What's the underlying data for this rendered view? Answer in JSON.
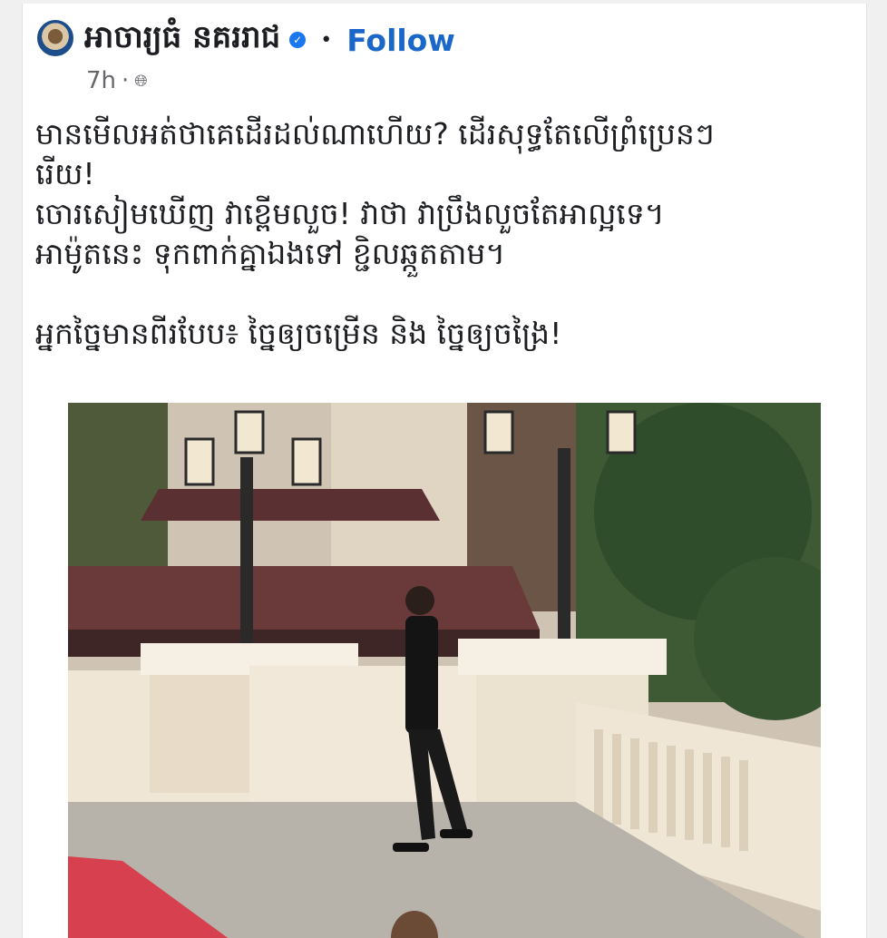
{
  "post": {
    "page_name": "អាចារ្យធំ នគររាជ",
    "follow_label": "Follow",
    "time": "7h",
    "privacy_icon": "globe-icon",
    "text_lines": [
      "មានមើលអត់ថាគេដើរដល់ណាហើយ? ដើរសុទ្ធតែលើព្រំប្រេនៗ",
      "រើយ!",
      "ចោរសៀមឃើញ វាខ្ពើមលួច! វាថា វាប្រឹងលួចតែអាល្អទេ។",
      "អាម៉ូតនេះ ទុកពាក់គ្នាឯងទៅ ខ្ជិលឆ្កួតតាម។",
      "",
      "អ្នកច្នៃមានពីរបែប៖ ច្នៃឲ្យចម្រើន និង ច្នៃឲ្យចង្រៃ!"
    ]
  },
  "colors": {
    "follow": "#1b66c9",
    "verified": "#1877f2",
    "red_carpet": "#d6404f"
  }
}
